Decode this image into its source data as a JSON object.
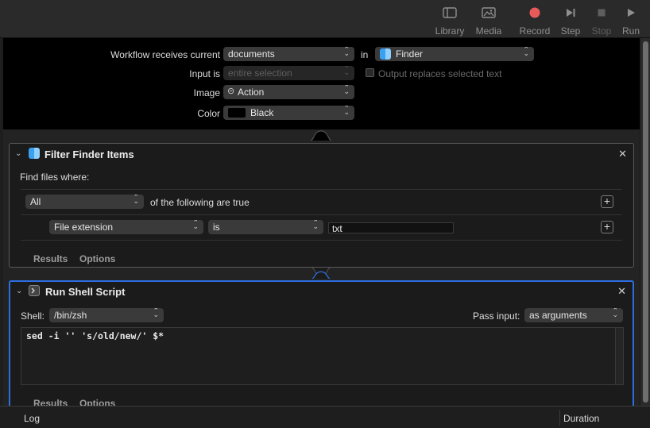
{
  "toolbar": {
    "library": "Library",
    "media": "Media",
    "record": "Record",
    "step": "Step",
    "stop": "Stop",
    "run": "Run",
    "record_color": "#e95b5b"
  },
  "workflow": {
    "receives_label": "Workflow receives current",
    "receives_value": "documents",
    "in_label": "in",
    "app_value": "Finder",
    "input_label": "Input is",
    "input_value": "entire selection",
    "output_replaces_label": "Output replaces selected text",
    "image_label": "Image",
    "image_value": "Action",
    "color_label": "Color",
    "color_value": "Black"
  },
  "filter_action": {
    "title": "Filter Finder Items",
    "find_label": "Find files where:",
    "match_value": "All",
    "match_suffix": "of the following are true",
    "criteria_field": "File extension",
    "criteria_op": "is",
    "criteria_value": "txt",
    "tab_results": "Results",
    "tab_options": "Options"
  },
  "shell_action": {
    "title": "Run Shell Script",
    "shell_label": "Shell:",
    "shell_value": "/bin/zsh",
    "pass_label": "Pass input:",
    "pass_value": "as arguments",
    "script": "sed -i '' 's/old/new/' $*",
    "tab_results": "Results",
    "tab_options": "Options"
  },
  "logbar": {
    "log": "Log",
    "duration": "Duration"
  },
  "accent_color": "#2c6ee0"
}
